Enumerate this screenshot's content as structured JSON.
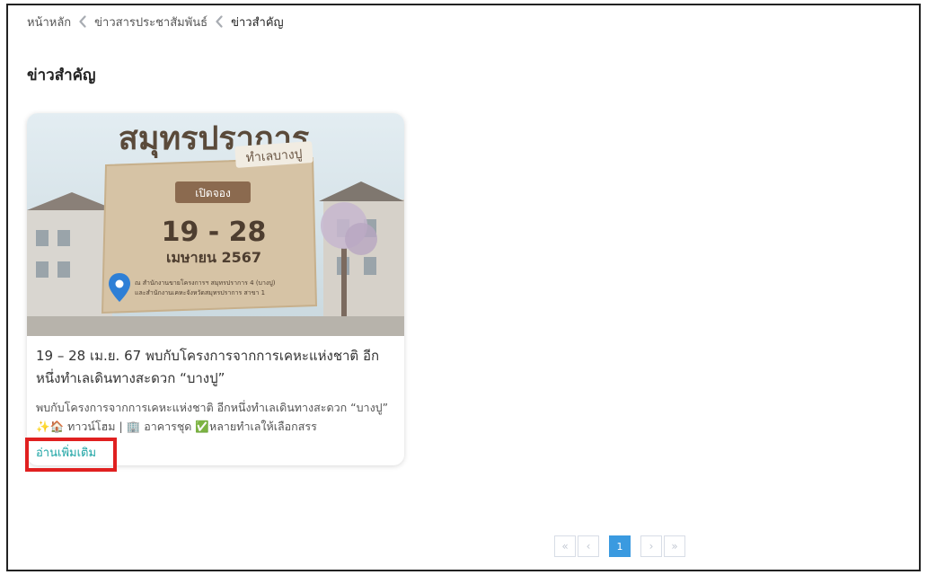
{
  "breadcrumb": {
    "home": "หน้าหลัก",
    "section": "ข่าวสารประชาสัมพันธ์",
    "current": "ข่าวสำคัญ"
  },
  "page": {
    "title": "ข่าวสำคัญ"
  },
  "card": {
    "image": {
      "heading": "สมุทรปราการ",
      "subheading": "ทำเลบางปู",
      "badge": "เปิดจอง",
      "dates": "19 - 28",
      "month": "เมษายน 2567",
      "location_line1": "ณ สำนักงานขายโครงการฯ สมุทรปราการ 4 (บางปู)",
      "location_line2": "และสำนักงานเคหะจังหวัดสมุทรปราการ สาขา 1"
    },
    "title": "19 – 28 เม.ย. 67 พบกับโครงการจากการเคหะแห่งชาติ อีกหนึ่งทำเลเดินทางสะดวก “บางปู”",
    "excerpt": "พบกับโครงการจากการเคหะแห่งชาติ อีกหนึ่งทำเลเดินทางสะดวก “บางปู” ✨🏠 ทาวน์โฮม | 🏢 อาคารชุด ✅หลายทำเลให้เลือกสรร",
    "read_more": "อ่านเพิ่มเติม"
  },
  "pagination": {
    "first": "«",
    "prev": "‹",
    "current_page": "1",
    "next": "›",
    "last": "»"
  },
  "colors": {
    "accent_link": "#1aa3a3",
    "page_active": "#3a9ae0",
    "highlight": "#e02020"
  }
}
